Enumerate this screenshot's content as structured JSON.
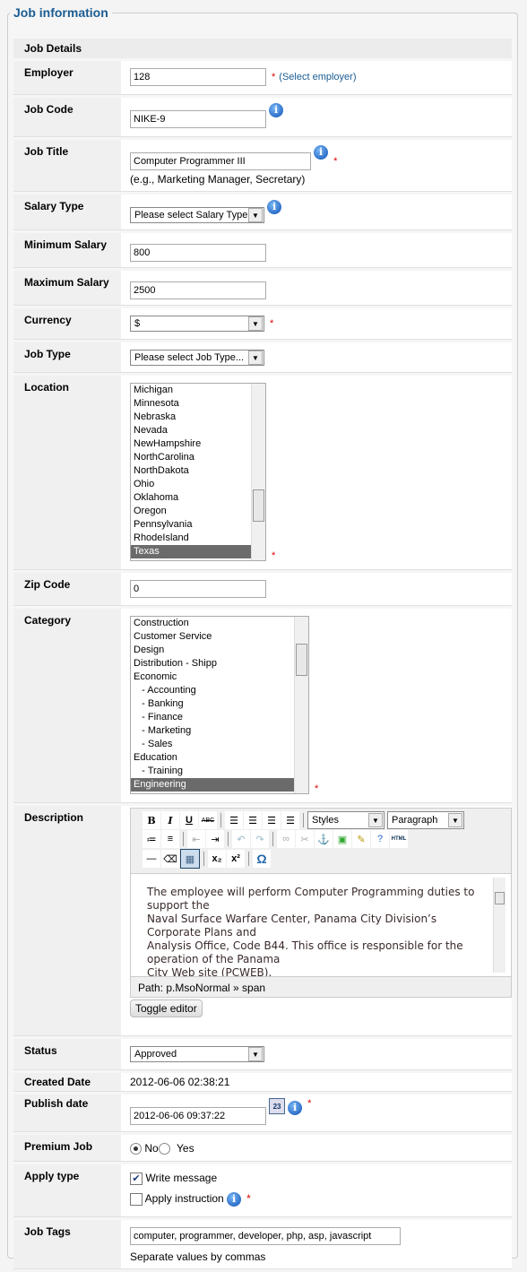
{
  "legend": "Job information",
  "section": "Job Details",
  "employer": {
    "label": "Employer",
    "value": "128",
    "link": "(Select employer)"
  },
  "job_code": {
    "label": "Job Code",
    "value": "NIKE-9"
  },
  "job_title": {
    "label": "Job Title",
    "value": "Computer Programmer III",
    "hint": "(e.g., Marketing Manager, Secretary)"
  },
  "salary_type": {
    "label": "Salary Type",
    "value": "Please select Salary Type"
  },
  "min_salary": {
    "label": "Minimum Salary",
    "value": "800"
  },
  "max_salary": {
    "label": "Maximum Salary",
    "value": "2500"
  },
  "currency": {
    "label": "Currency",
    "value": "$"
  },
  "job_type": {
    "label": "Job Type",
    "value": "Please select Job Type..."
  },
  "location": {
    "label": "Location",
    "options": [
      "Michigan",
      "Minnesota",
      "Nebraska",
      "Nevada",
      "NewHampshire",
      "NorthCarolina",
      "NorthDakota",
      "Ohio",
      "Oklahoma",
      "Oregon",
      "Pennsylvania",
      "RhodeIsland",
      "Texas"
    ],
    "selected": "Texas"
  },
  "zip": {
    "label": "Zip Code",
    "value": "0"
  },
  "category": {
    "label": "Category",
    "options": [
      "Construction",
      "Customer Service",
      "Design",
      "Distribution - Shipp",
      "Economic",
      "   - Accounting",
      "   - Banking",
      "   - Finance",
      "   - Marketing",
      "   - Sales",
      "Education",
      "   - Training",
      "Engineering"
    ],
    "selected": "Engineering"
  },
  "description": {
    "label": "Description",
    "styles": "Styles",
    "format": "Paragraph",
    "lines": [
      "The employee will perform Computer Programming duties to support the",
      "Naval Surface Warfare Center, Panama City Division’s Corporate Plans and",
      "Analysis Office, Code B44. This office is responsible for the operation of the Panama",
      "City Web site (PCWEB)."
    ],
    "path": "Path: p.MsoNormal » span",
    "toggle": "Toggle editor",
    "html_btn": "HTML"
  },
  "status": {
    "label": "Status",
    "value": "Approved"
  },
  "created": {
    "label": "Created Date",
    "value": "2012-06-06 02:38:21"
  },
  "publish": {
    "label": "Publish date",
    "value": "2012-06-06 09:37:22",
    "cal": "23"
  },
  "premium": {
    "label": "Premium Job",
    "no": "No",
    "yes": "Yes",
    "selected": "No"
  },
  "apply": {
    "label": "Apply type",
    "write": "Write message",
    "write_checked": true,
    "instruction": "Apply instruction",
    "instruction_checked": false
  },
  "tags": {
    "label": "Job Tags",
    "value": "computer, programmer, developer, php, asp, javascript",
    "hint": "Separate values by commas"
  },
  "req": "*",
  "info": "i"
}
